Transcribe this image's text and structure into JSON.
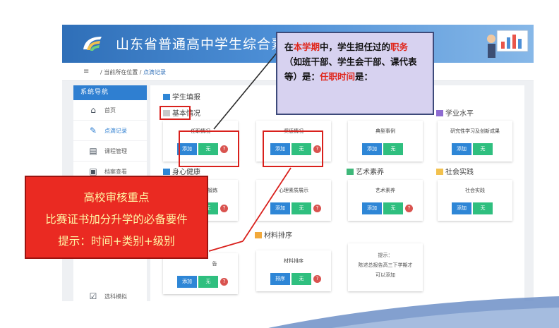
{
  "header": {
    "title": "山东省普通高中学生综合素质评"
  },
  "breadcrumb": {
    "current_location_label": "当前所在位置",
    "separator": "/",
    "current_page": "点滴记录"
  },
  "sidebar": {
    "heading": "系统导航",
    "items": [
      {
        "label": "首页",
        "icon": "home-icon"
      },
      {
        "label": "点滴记录",
        "icon": "edit-icon",
        "active": true
      },
      {
        "label": "课程管理",
        "icon": "course-icon"
      },
      {
        "label": "档案查看",
        "icon": "archive-icon"
      },
      {
        "label": "选科模拟",
        "icon": "checklist-icon"
      }
    ]
  },
  "sections": {
    "student_fill": "学生填报",
    "basic_info": "基本情况",
    "physical_health": "身心健康",
    "art": "艺术素养",
    "social_practice": "社会实践",
    "academic_level": "学业水平",
    "material_sorting": "材料排序"
  },
  "cards": {
    "tenure": {
      "title": "任职情况",
      "add": "添加",
      "none": "无",
      "help": "?"
    },
    "awards": {
      "title": "奖惩情况",
      "add": "添加",
      "none": "无",
      "help": "?"
    },
    "typical_cases": {
      "title": "典型事例",
      "add": "添加",
      "none": "无"
    },
    "research": {
      "title": "研究性学习及创新成果",
      "add": "添加",
      "none": "无"
    },
    "physical": {
      "title": "育锻炼",
      "add": "添加",
      "none": "无",
      "help": "?"
    },
    "mental": {
      "title": "心理素质展示",
      "add": "添加",
      "none": "无",
      "help": "?"
    },
    "art_card": {
      "title": "艺术素养",
      "add": "添加",
      "none": "无",
      "help": "?"
    },
    "social_card": {
      "title": "社会实践",
      "add": "添加",
      "none": "无"
    },
    "report": {
      "title": "告",
      "add": "添加",
      "none": "无",
      "help": "?"
    },
    "material": {
      "title": "材料排序",
      "sort": "排序",
      "none": "无",
      "help": "?"
    }
  },
  "notice": {
    "line1": "提示：",
    "line2": "陈述总报告高三下学期才",
    "line3": "可以添加"
  },
  "callout_blue": {
    "p1": "在",
    "p2": "本学期",
    "p3": "中，学生担任过的",
    "p4": "职务",
    "p5": "（如班干部、学生会干部、课代表等）是：",
    "p6": "任职时间",
    "p7": "是："
  },
  "callout_red": {
    "line1": "高校审核重点",
    "line2": "比赛证书加分升学的必备要件",
    "line3": "提示：时间+类别+级别"
  },
  "colors": {
    "primary_blue": "#2e86d6",
    "green": "#2fbf7f",
    "highlight_red": "#d9201c",
    "callout_red": "#ea2a22",
    "callout_text_yellow": "#fff7a6",
    "callout_blue_bg": "#d7d2f0"
  }
}
